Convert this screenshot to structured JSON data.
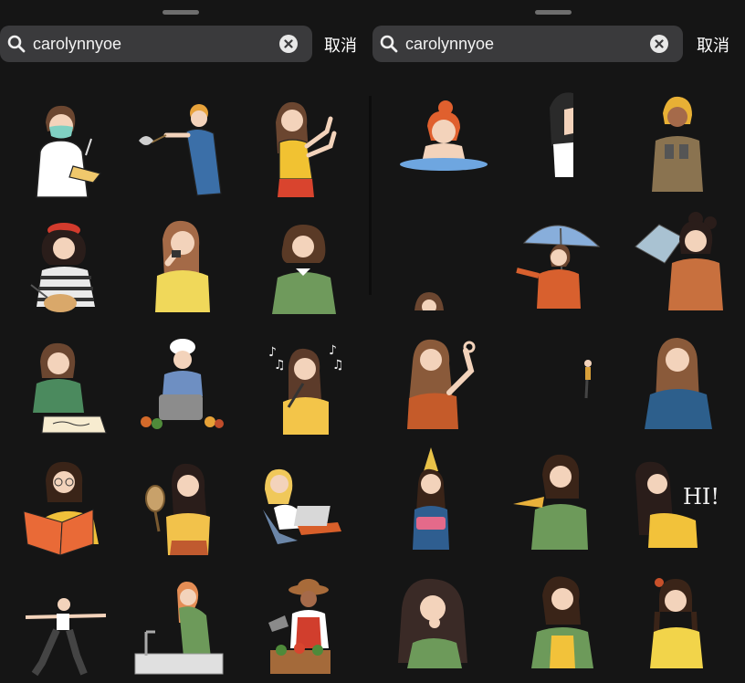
{
  "panels": [
    {
      "search": {
        "value": "carolynnyoe",
        "placeholder": ""
      },
      "cancel_label": "取消"
    },
    {
      "search": {
        "value": "carolynnyoe",
        "placeholder": ""
      },
      "cancel_label": "取消"
    }
  ],
  "stickers": {
    "hi_text": "HI!"
  },
  "colors": {
    "background": "#151515",
    "search_bg": "#3a3a3c",
    "text": "#f2f2f2"
  }
}
